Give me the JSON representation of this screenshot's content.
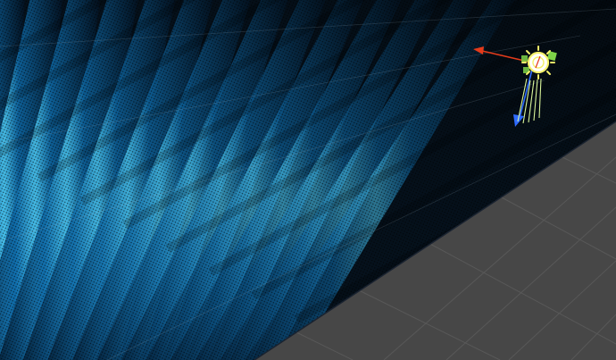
{
  "scene_view": {
    "background_color": "#474747",
    "grid_line_color": "#5a5a5a",
    "plane": {
      "base_color": "#06131f",
      "wave_highlight_color": "#4fd2ff",
      "wave_mid_color": "#0f6fb0",
      "wave_shadow_color": "#031426",
      "texture": "perforated-metal-dots",
      "wave_ridge_count": 14
    },
    "selected_object": {
      "type": "directional-light",
      "icon": "sun-light-icon",
      "icon_color": "#f4f06a",
      "ray_color": "#d9f59a"
    },
    "transform_gizmo": {
      "x_axis_color": "#e43b1b",
      "y_axis_color": "#7ed348",
      "z_axis_color": "#2f6bff"
    }
  }
}
